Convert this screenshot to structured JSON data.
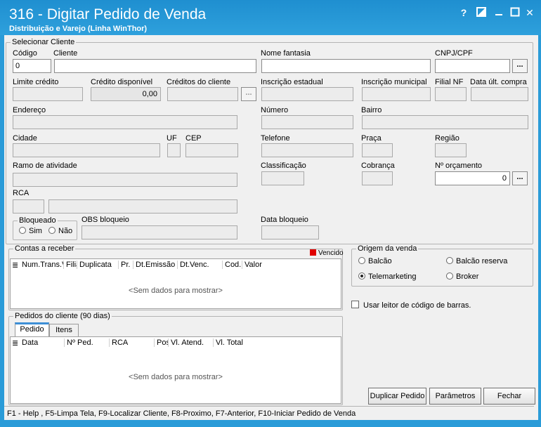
{
  "window": {
    "title": "316 - Digitar Pedido de Venda",
    "subtitle": "Distribuição e Varejo (Linha WinThor)",
    "help_glyph": "?",
    "close_glyph": "✕"
  },
  "cliente": {
    "group_label": "Selecionar Cliente",
    "codigo_label": "Código",
    "codigo_value": "0",
    "cliente_label": "Cliente",
    "nome_fantasia_label": "Nome fantasia",
    "cnpj_label": "CNPJ/CPF",
    "limite_credito_label": "Limite crédito",
    "credito_disponivel_label": "Crédito disponível",
    "credito_disponivel_value": "0,00",
    "creditos_cliente_label": "Créditos do cliente",
    "inscricao_estadual_label": "Inscrição estadual",
    "inscricao_municipal_label": "Inscrição municipal",
    "filial_nf_label": "Filial NF",
    "data_ult_compra_label": "Data últ. compra",
    "endereco_label": "Endereço",
    "numero_label": "Número",
    "bairro_label": "Bairro",
    "cidade_label": "Cidade",
    "uf_label": "UF",
    "cep_label": "CEP",
    "telefone_label": "Telefone",
    "praca_label": "Praça",
    "regiao_label": "Região",
    "ramo_label": "Ramo de atividade",
    "classificacao_label": "Classificação",
    "cobranca_label": "Cobrança",
    "orcamento_label": "Nº orçamento",
    "orcamento_value": "0",
    "rca_label": "RCA",
    "bloqueado_label": "Bloqueado",
    "sim_label": "Sim",
    "nao_label": "Não",
    "obs_bloqueio_label": "OBS bloqueio",
    "data_bloqueio_label": "Data bloqueio",
    "dots_label": "..."
  },
  "contas": {
    "group_label": "Contas a receber",
    "vencido_label": "Vencido",
    "vencido_color": "#e00000",
    "columns": [
      "Num.Trans.V",
      "Filia",
      "Duplicata",
      "Pr.",
      "Dt.Emissão",
      "Dt.Venc.",
      "Cod.",
      "Valor"
    ],
    "empty_text": "<Sem dados para mostrar>"
  },
  "origem": {
    "group_label": "Origem da venda",
    "balcao": "Balcão",
    "balcao_reserva": "Balcão reserva",
    "telemarketing": "Telemarketing",
    "broker": "Broker",
    "selected": "telemarketing"
  },
  "leitor_label": "Usar leitor de código de barras.",
  "pedidos": {
    "group_label": "Pedidos do cliente (90 dias)",
    "tab_pedido": "Pedido",
    "tab_itens": "Itens",
    "columns": [
      "Data",
      "Nº Ped.",
      "RCA",
      "Pos",
      "Vl. Atend.",
      "Vl. Total"
    ],
    "empty_text": "<Sem dados para mostrar>"
  },
  "buttons": {
    "duplicar": "Duplicar Pedido",
    "parametros": "Parâmetros",
    "fechar": "Fechar"
  },
  "status_bar": "F1 - Help , F5-Limpa Tela, F9-Localizar Cliente, F8-Proximo, F7-Anterior, F10-Iniciar Pedido de Venda"
}
